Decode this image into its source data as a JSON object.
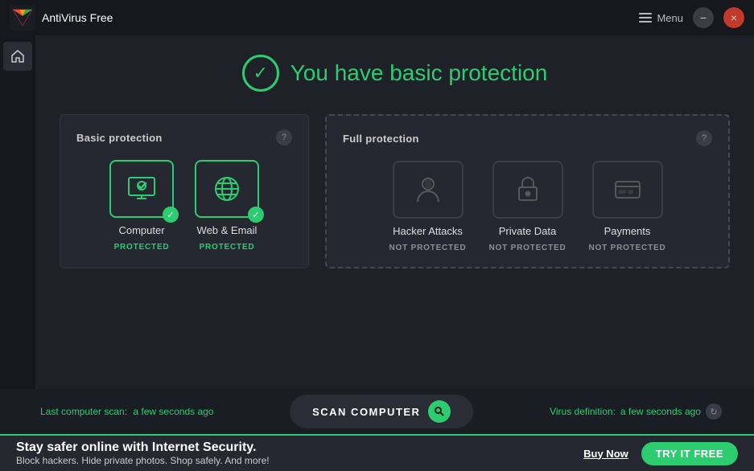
{
  "titlebar": {
    "app_name": "AntiVirus Free",
    "menu_label": "Menu",
    "minimize_label": "−",
    "close_label": "×"
  },
  "hero": {
    "title": "You have basic protection"
  },
  "basic_card": {
    "title": "Basic protection",
    "help": "?"
  },
  "full_card": {
    "title": "Full protection",
    "help": "?"
  },
  "basic_items": [
    {
      "name": "Computer",
      "status": "PROTECTED",
      "protected": true
    },
    {
      "name": "Web & Email",
      "status": "PROTECTED",
      "protected": true
    }
  ],
  "full_items": [
    {
      "name": "Hacker Attacks",
      "status": "NOT PROTECTED"
    },
    {
      "name": "Private Data",
      "status": "NOT PROTECTED"
    },
    {
      "name": "Payments",
      "status": "NOT PROTECTED"
    }
  ],
  "bottom_bar": {
    "scan_label": "Last computer scan:",
    "scan_time": "a few seconds ago",
    "scan_button": "SCAN COMPUTER",
    "virus_label": "Virus definition:",
    "virus_time": "a few seconds ago"
  },
  "promo": {
    "title": "Stay safer online with Internet Security.",
    "subtitle": "Block hackers. Hide private photos. Shop safely. And more!",
    "buy_label": "Buy Now",
    "try_label": "TRY IT FREE"
  }
}
